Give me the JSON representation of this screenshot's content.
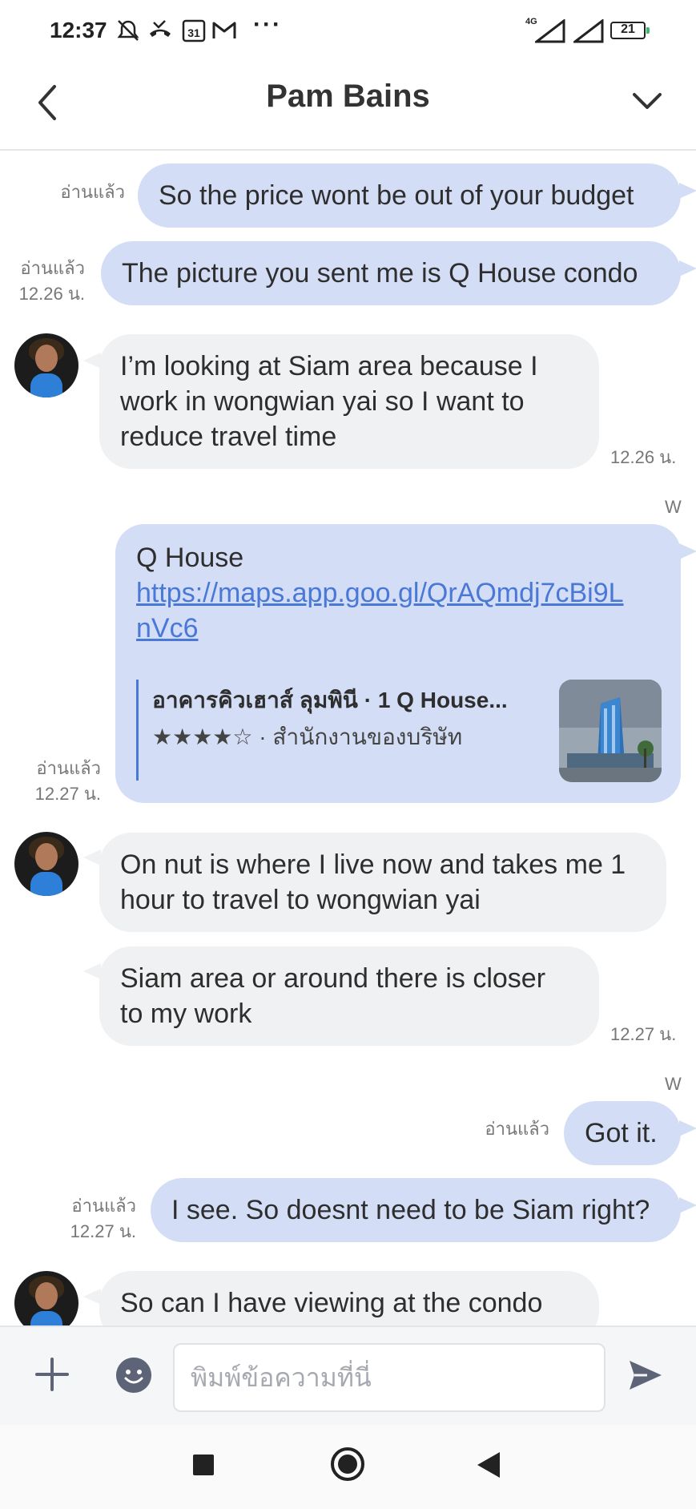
{
  "status_bar": {
    "time": "12:37",
    "calendar_day": "31",
    "network": "4G",
    "battery": "21"
  },
  "header": {
    "title": "Pam Bains"
  },
  "messages": {
    "m1": {
      "text": "So the price wont be out of your budget",
      "read": "อ่านแล้ว"
    },
    "m2": {
      "text": "The picture you sent me is Q House condo",
      "read": "อ่านแล้ว",
      "time": "12.26 น."
    },
    "m3": {
      "lines": [
        "I’m looking at Siam area because I",
        "work in wongwian yai so I want to",
        "reduce travel time"
      ],
      "time": "12.26 น."
    },
    "sender_w1": "W",
    "m4": {
      "title": "Q House",
      "link_lines": [
        "https://maps.app.goo.gl/QrAQmdj7cBi9L",
        "nVc6"
      ],
      "preview_title": "อาคารคิวเฮาส์ ลุมพินี · 1 Q House...",
      "preview_rating": "★★★★☆",
      "preview_sub": " · สำนักงานของบริษัท",
      "read": "อ่านแล้ว",
      "time": "12.27 น."
    },
    "m5": {
      "lines": [
        "On nut is where I live now and takes me 1",
        "hour to travel to wongwian yai"
      ]
    },
    "m6": {
      "lines": [
        "Siam area or around there is closer",
        "to my work"
      ],
      "time": "12.27 น."
    },
    "sender_w2": "W",
    "m7": {
      "text": "Got it.",
      "read": "อ่านแล้ว"
    },
    "m8": {
      "text": "I see. So doesnt need to be Siam right?",
      "read": "อ่านแล้ว",
      "time": "12.27 น."
    },
    "m9": {
      "text": "So can I have viewing at the condo"
    }
  },
  "input": {
    "placeholder": "พิมพ์ข้อความที่นี่"
  },
  "colors": {
    "outgoing_bubble": "#d3def6",
    "incoming_bubble": "#f0f1f3",
    "link": "#4a78d6"
  }
}
